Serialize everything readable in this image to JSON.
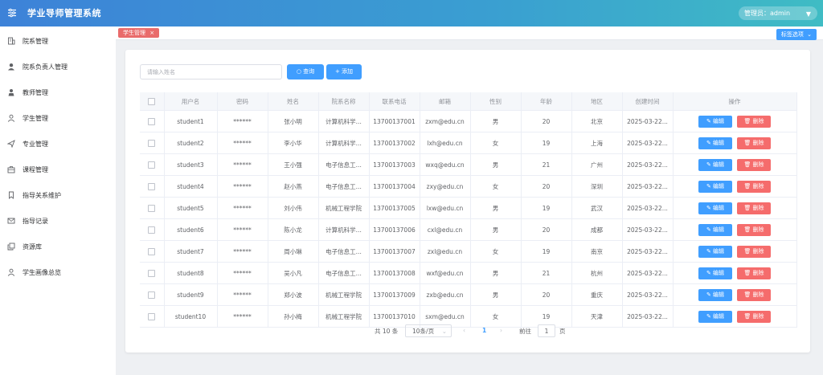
{
  "app": {
    "title": "学业导师管理系统",
    "user_label": "管理员：admin"
  },
  "sidebar": {
    "items": [
      {
        "label": "院系管理",
        "icon": "building-icon"
      },
      {
        "label": "院系负责人管理",
        "icon": "user-solid-icon"
      },
      {
        "label": "教师管理",
        "icon": "teacher-icon"
      },
      {
        "label": "学生管理",
        "icon": "user-outline-icon"
      },
      {
        "label": "专业管理",
        "icon": "send-icon"
      },
      {
        "label": "课程管理",
        "icon": "briefcase-icon"
      },
      {
        "label": "指导关系维护",
        "icon": "bookmark-icon"
      },
      {
        "label": "指导记录",
        "icon": "message-icon"
      },
      {
        "label": "资源库",
        "icon": "copy-icon"
      },
      {
        "label": "学生画像总览",
        "icon": "user-outline-icon"
      }
    ]
  },
  "tags": {
    "active": "学生管理",
    "close": "×",
    "options_label": "标签选项"
  },
  "toolbar": {
    "search_placeholder": "请输入姓名",
    "search_label": "查询",
    "add_label": "添加"
  },
  "table": {
    "columns": [
      "用户名",
      "密码",
      "姓名",
      "院系名称",
      "联系电话",
      "邮箱",
      "性别",
      "年龄",
      "地区",
      "创建时间",
      "操作"
    ],
    "rows": [
      [
        "student1",
        "******",
        "张小明",
        "计算机科学...",
        "13700137001",
        "zxm@edu.cn",
        "男",
        "20",
        "北京",
        "2025-03-22..."
      ],
      [
        "student2",
        "******",
        "李小华",
        "计算机科学...",
        "13700137002",
        "lxh@edu.cn",
        "女",
        "19",
        "上海",
        "2025-03-22..."
      ],
      [
        "student3",
        "******",
        "王小强",
        "电子信息工...",
        "13700137003",
        "wxq@edu.cn",
        "男",
        "21",
        "广州",
        "2025-03-22..."
      ],
      [
        "student4",
        "******",
        "赵小燕",
        "电子信息工...",
        "13700137004",
        "zxy@edu.cn",
        "女",
        "20",
        "深圳",
        "2025-03-22..."
      ],
      [
        "student5",
        "******",
        "刘小伟",
        "机械工程学院",
        "13700137005",
        "lxw@edu.cn",
        "男",
        "19",
        "武汉",
        "2025-03-22..."
      ],
      [
        "student6",
        "******",
        "陈小龙",
        "计算机科学...",
        "13700137006",
        "cxl@edu.cn",
        "男",
        "20",
        "成都",
        "2025-03-22..."
      ],
      [
        "student7",
        "******",
        "周小琳",
        "电子信息工...",
        "13700137007",
        "zxl@edu.cn",
        "女",
        "19",
        "南京",
        "2025-03-22..."
      ],
      [
        "student8",
        "******",
        "吴小凡",
        "电子信息工...",
        "13700137008",
        "wxf@edu.cn",
        "男",
        "21",
        "杭州",
        "2025-03-22..."
      ],
      [
        "student9",
        "******",
        "郑小波",
        "机械工程学院",
        "13700137009",
        "zxb@edu.cn",
        "男",
        "20",
        "重庆",
        "2025-03-22..."
      ],
      [
        "student10",
        "******",
        "孙小梅",
        "机械工程学院",
        "13700137010",
        "sxm@edu.cn",
        "女",
        "19",
        "天津",
        "2025-03-22..."
      ]
    ],
    "edit_label": "编辑",
    "delete_label": "删除"
  },
  "pagination": {
    "total": "共 10 条",
    "page_size": "10条/页",
    "prev": "‹",
    "current": "1",
    "next": "›",
    "goto": "前往",
    "goto_value": "1",
    "unit": "页"
  },
  "colors": {
    "primary": "#409eff",
    "danger": "#f56c6c",
    "tag": "#e96b6b"
  }
}
